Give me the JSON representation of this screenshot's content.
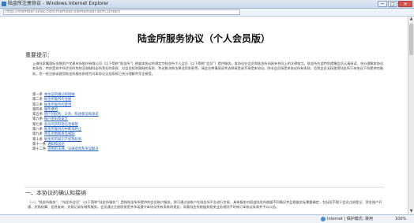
{
  "window": {
    "title": "陆金所注册协议 - Windows Internet Explorer",
    "min_glyph": "─",
    "max_glyph": "□",
    "close_glyph": "✕"
  },
  "address": {
    "url": "http://member.lufax.com/member/listMemberTerm.screen"
  },
  "page": {
    "title": "陆金所服务协议（个人会员版）",
    "important_heading": "重要提示：",
    "intro": "上海陆家嘴国际金融资产交易市场股份有限公司（以下简称“陆金所”）依据本协议的规定为陆金所个人会员（以下简称“会员”）提供服务，本协议在会员和陆金所间具有合同上的法律效力。陆金所在此特别提醒会员认真阅读、充分理解本协议各条款，特别是其中所涉及的免除及限制陆金所责任的条款、对会员权利限制的条款、争议解决和法律适用条款等，请会员审慎阅读并选择接受或不接受本协议。除非会员接受本协议所有条款，否则会员无权使用陆金所于本协议下所提供的服务。您一经注册或使用陆金所服务即视为对本协议全部条款已充分理解并完全接受。",
    "toc": [
      {
        "num": "第一条",
        "label": "本协议的确认和接纳"
      },
      {
        "num": "第二条",
        "label": "陆金所服务的注册"
      },
      {
        "num": "第三条",
        "label": "陆金所服务的使用"
      },
      {
        "num": "第四条",
        "label": "服务费用"
      },
      {
        "num": "第五条",
        "label": "用户的权利、义务、陈述保证和承诺"
      },
      {
        "num": "第六条",
        "label": "账户密码及安全"
      },
      {
        "num": "第七条",
        "label": "会员的资料及信息保管"
      },
      {
        "num": "第八条",
        "label": "陆金所服务的中断或终止"
      },
      {
        "num": "第九条",
        "label": "责任范围和责任限制"
      },
      {
        "num": "第十条",
        "label": "陆金所的知识产权等权利"
      },
      {
        "num": "第十一条",
        "label": "通知和送达"
      },
      {
        "num": "第十二条",
        "label": "适用的法律、法律适用及争议解决"
      }
    ],
    "section1_heading": "一、本协议的确认和接纳",
    "section1_body": "（一）“陆金所服务”、“陆金所会员”（以下简称“陆金所服务”）是指陆金所所提供的会员账户服务，即可通过该账户在陆金所平台进行交易，具体服务内容由陆金所根据不同情况并且根据实际需要确定，包括但不限于会员注册登记、资金账户开通、交易结算、信息查询、交易记录存储等服务。会员通过注册即接受并承诺遵守本协议所有条款的规定，同意陆金所根据其相关业务规则不时修订本协议条款并予以公告。"
  },
  "status": {
    "zone": "Internet | 保护模式: 禁用",
    "zoom": "100%"
  }
}
